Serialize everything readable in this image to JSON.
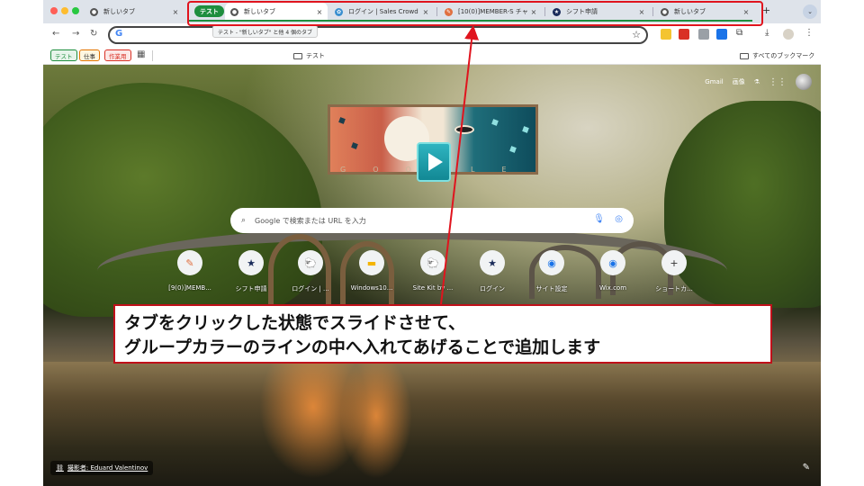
{
  "tabs": [
    {
      "label": "新しいタブ",
      "close": "×"
    },
    {
      "label": "新しいタブ",
      "close": "×"
    },
    {
      "label": "ログイン | Sales Crowd",
      "close": "×"
    },
    {
      "label": "[10(0)]MEMBER-S チャ",
      "close": "×"
    },
    {
      "label": "シフト申請",
      "close": "×"
    },
    {
      "label": "新しいタブ",
      "close": "×"
    }
  ],
  "tab_group": {
    "label": "テスト",
    "color": "#1e8e3e"
  },
  "tooltip": "テスト - \"新しいタブ\" と他 4 個のタブ",
  "new_tab": "+",
  "bookmarks": {
    "chips": [
      {
        "label": "テスト",
        "color": "#1e8e3e"
      },
      {
        "label": "仕事",
        "color": "#e37400"
      },
      {
        "label": "作業用",
        "color": "#d93025"
      }
    ],
    "folder": "テスト",
    "all_bookmarks": "すべてのブックマーク"
  },
  "page": {
    "gmail": "Gmail",
    "images": "画像",
    "search_placeholder": "Google で検索または URL を入力",
    "doodle_letters": "GOOGLE",
    "shortcuts": [
      {
        "label": "[9(0)]MEMB...",
        "icon": "✎"
      },
      {
        "label": "シフト申請",
        "icon": "★"
      },
      {
        "label": "ログイン | ...",
        "icon": "🐑"
      },
      {
        "label": "Windows10...",
        "icon": "▬"
      },
      {
        "label": "Site Kit by ...",
        "icon": "🐑"
      },
      {
        "label": "ログイン",
        "icon": "★"
      },
      {
        "label": "サイト設定",
        "icon": "◉"
      },
      {
        "label": "Wix.com",
        "icon": "◉"
      },
      {
        "label": "ショートカ...",
        "icon": "+"
      }
    ],
    "credit": "撮影者: Eduard Valentinov"
  },
  "annotation": {
    "line1": "タブをクリックした状態でスライドさせて、",
    "line2": "グループカラーのラインの中へ入れてあげることで追加します",
    "color": "#e0141e"
  }
}
